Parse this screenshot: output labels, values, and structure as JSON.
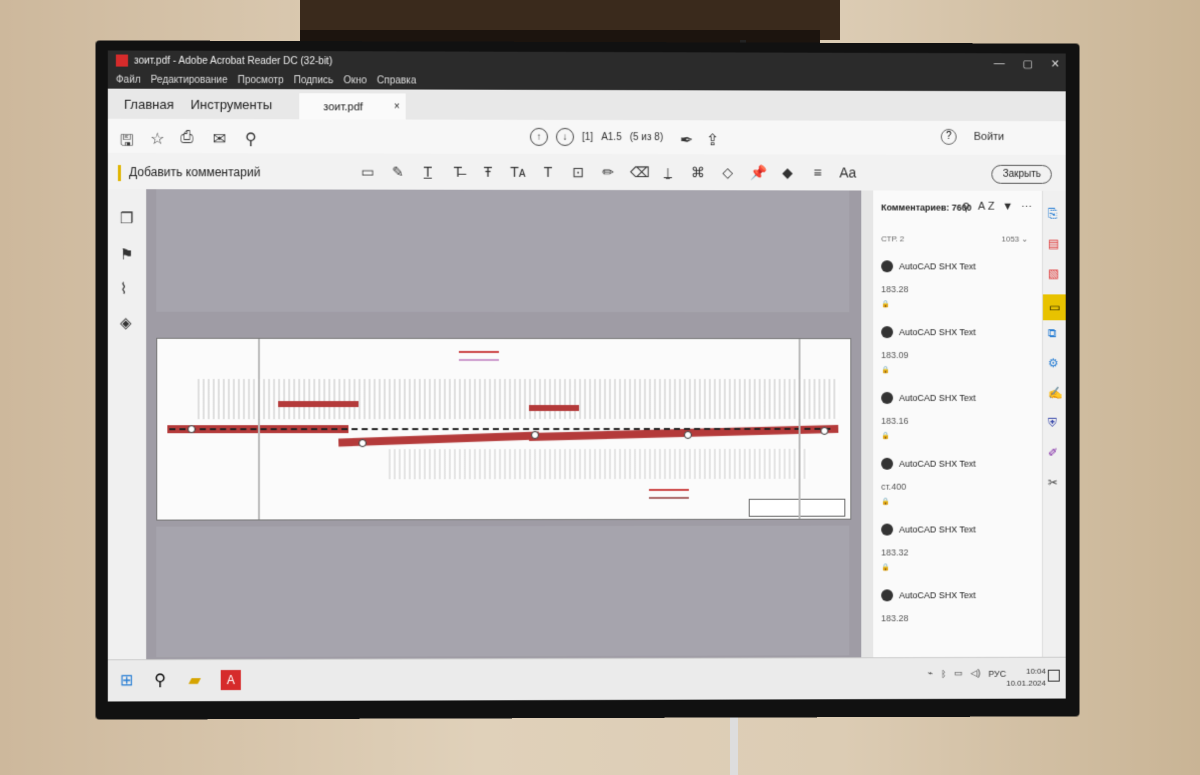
{
  "window": {
    "title": "зоит.pdf - Adobe Acrobat Reader DC (32-bit)",
    "min": "—",
    "max": "▢",
    "close": "✕"
  },
  "menu": [
    "Файл",
    "Редактирование",
    "Просмотр",
    "Подпись",
    "Окно",
    "Справка"
  ],
  "tabs": {
    "home": "Главная",
    "tools": "Инструменты",
    "document": "зоит.pdf",
    "close": "×"
  },
  "toolbar": {
    "page_current": "[1]",
    "page_of": "А1.5",
    "page_total": "(5 из 8)",
    "help": "?",
    "sign_in": "Войти"
  },
  "comment_bar": {
    "title": "Добавить комментарий",
    "close": "Закрыть",
    "text_tool": "Aa"
  },
  "comments_panel": {
    "header": "Комментариев: 7600",
    "sort": "A Z",
    "page_label": "СТР. 2",
    "page_count": "1053 ⌄",
    "items": [
      {
        "name": "AutoCAD SHX Text",
        "value": "183.28"
      },
      {
        "name": "AutoCAD SHX Text",
        "value": "183.09"
      },
      {
        "name": "AutoCAD SHX Text",
        "value": "183.16"
      },
      {
        "name": "AutoCAD SHX Text",
        "value": "ст.400"
      },
      {
        "name": "AutoCAD SHX Text",
        "value": "183.32"
      },
      {
        "name": "AutoCAD SHX Text",
        "value": "183.28"
      }
    ]
  },
  "taskbar": {
    "language": "РУС",
    "time": "10:04",
    "date": "10.01.2024"
  },
  "colors": {
    "accent": "#e8c200",
    "title_bar": "#2b2b2b",
    "pdf_red": "#d62b2b",
    "road": "#b43a3a"
  }
}
